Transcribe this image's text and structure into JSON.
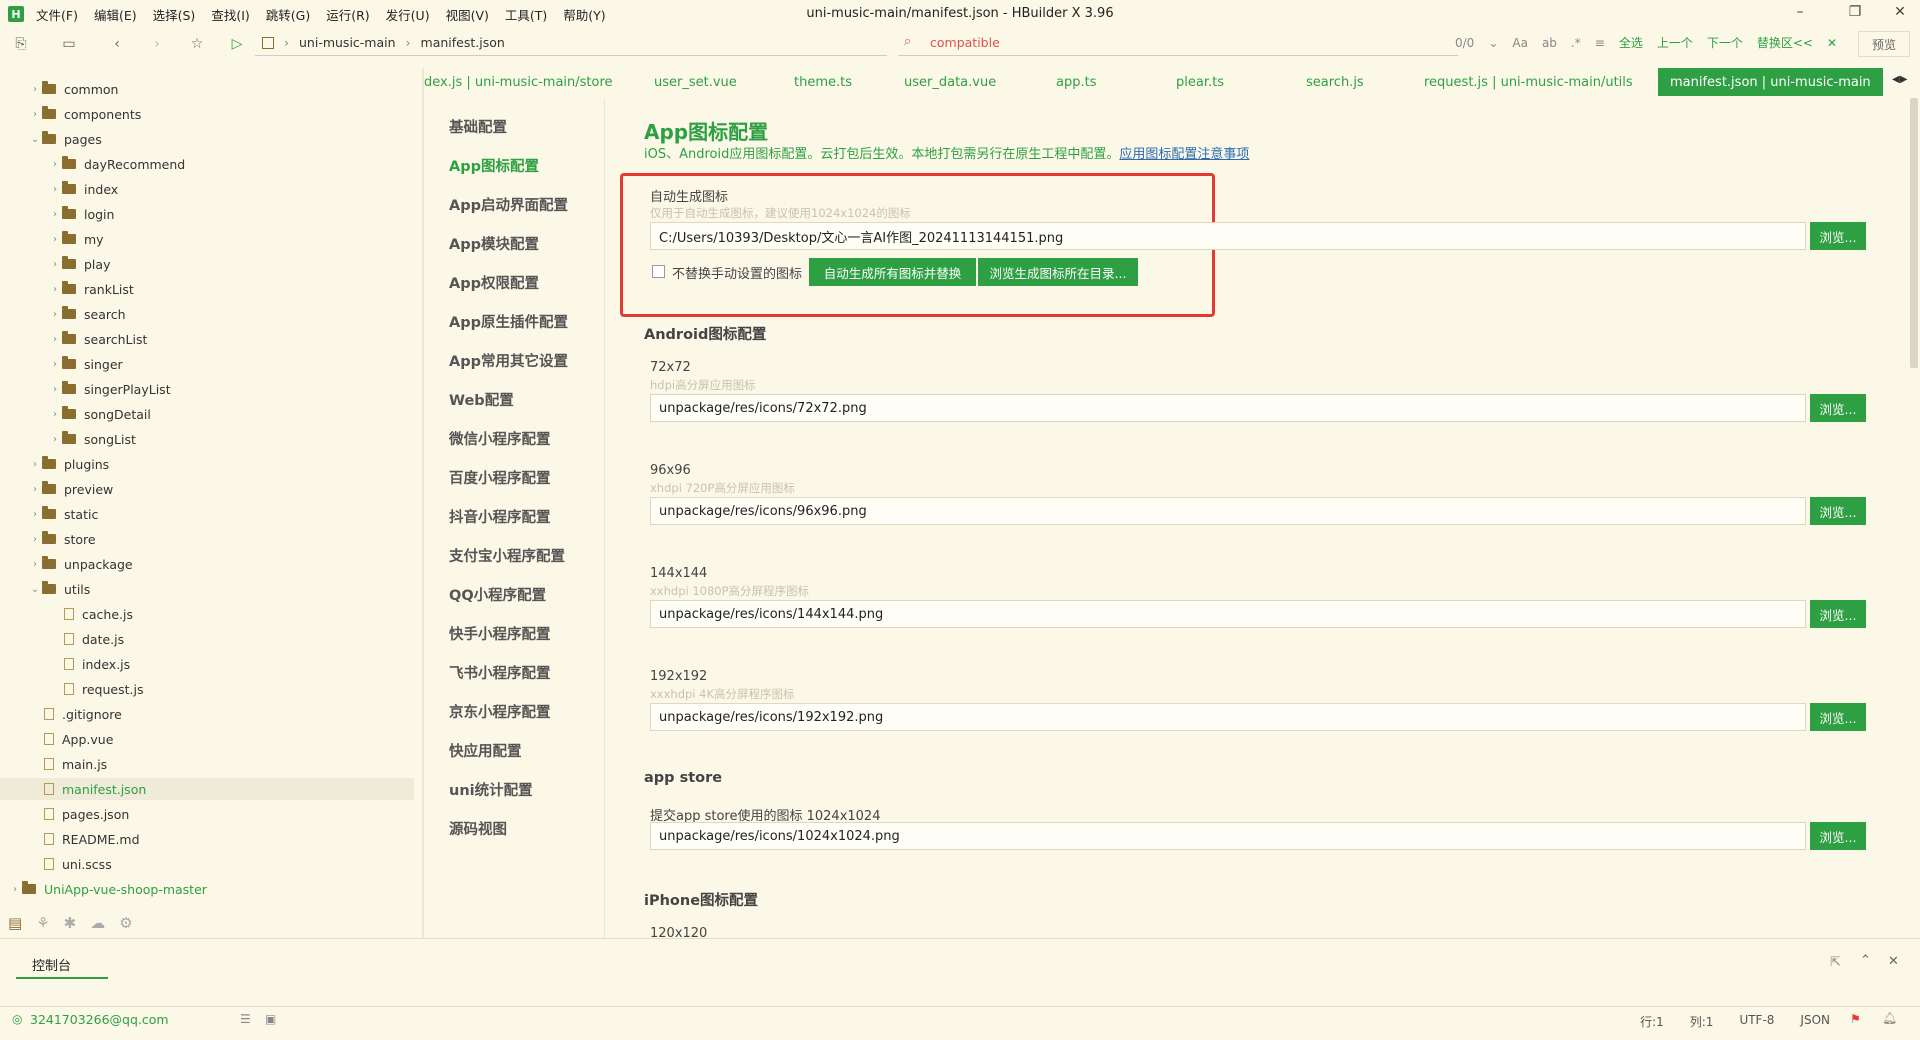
{
  "window": {
    "title": "uni-music-main/manifest.json - HBuilder X 3.96",
    "menu": [
      "文件(F)",
      "编辑(E)",
      "选择(S)",
      "查找(I)",
      "跳转(G)",
      "运行(R)",
      "发行(U)",
      "视图(V)",
      "工具(T)",
      "帮助(Y)"
    ]
  },
  "toolbar": {
    "breadcrumb": [
      "uni-music-main",
      "manifest.json"
    ],
    "search_value": "compatible",
    "match_count": "0/0",
    "find_select_all": "全选",
    "find_prev": "上一个",
    "find_next": "下一个",
    "find_replace": "替换区<<",
    "preview": "预览"
  },
  "tree": [
    {
      "label": "common",
      "type": "folder",
      "depth": 0,
      "expanded": false
    },
    {
      "label": "components",
      "type": "folder",
      "depth": 0,
      "expanded": false
    },
    {
      "label": "pages",
      "type": "folder",
      "depth": 0,
      "expanded": true
    },
    {
      "label": "dayRecommend",
      "type": "folder",
      "depth": 1,
      "expanded": false
    },
    {
      "label": "index",
      "type": "folder",
      "depth": 1,
      "expanded": false
    },
    {
      "label": "login",
      "type": "folder",
      "depth": 1,
      "expanded": false
    },
    {
      "label": "my",
      "type": "folder",
      "depth": 1,
      "expanded": false
    },
    {
      "label": "play",
      "type": "folder",
      "depth": 1,
      "expanded": false
    },
    {
      "label": "rankList",
      "type": "folder",
      "depth": 1,
      "expanded": false
    },
    {
      "label": "search",
      "type": "folder",
      "depth": 1,
      "expanded": false
    },
    {
      "label": "searchList",
      "type": "folder",
      "depth": 1,
      "expanded": false
    },
    {
      "label": "singer",
      "type": "folder",
      "depth": 1,
      "expanded": false
    },
    {
      "label": "singerPlayList",
      "type": "folder",
      "depth": 1,
      "expanded": false
    },
    {
      "label": "songDetail",
      "type": "folder",
      "depth": 1,
      "expanded": false
    },
    {
      "label": "songList",
      "type": "folder",
      "depth": 1,
      "expanded": false
    },
    {
      "label": "plugins",
      "type": "folder",
      "depth": 0,
      "expanded": false
    },
    {
      "label": "preview",
      "type": "folder",
      "depth": 0,
      "expanded": false
    },
    {
      "label": "static",
      "type": "folder",
      "depth": 0,
      "expanded": false
    },
    {
      "label": "store",
      "type": "folder",
      "depth": 0,
      "expanded": false
    },
    {
      "label": "unpackage",
      "type": "folder",
      "depth": 0,
      "expanded": false
    },
    {
      "label": "utils",
      "type": "folder",
      "depth": 0,
      "expanded": true
    },
    {
      "label": "cache.js",
      "type": "file",
      "depth": 1
    },
    {
      "label": "date.js",
      "type": "file",
      "depth": 1
    },
    {
      "label": "index.js",
      "type": "file",
      "depth": 1
    },
    {
      "label": "request.js",
      "type": "file",
      "depth": 1
    },
    {
      "label": ".gitignore",
      "type": "file",
      "depth": 0
    },
    {
      "label": "App.vue",
      "type": "file",
      "depth": 0
    },
    {
      "label": "main.js",
      "type": "file",
      "depth": 0
    },
    {
      "label": "manifest.json",
      "type": "file",
      "depth": 0,
      "active": true
    },
    {
      "label": "pages.json",
      "type": "file",
      "depth": 0
    },
    {
      "label": "README.md",
      "type": "file",
      "depth": 0
    },
    {
      "label": "uni.scss",
      "type": "file",
      "depth": 0
    },
    {
      "label": "UniApp-vue-shoop-master",
      "type": "project",
      "depth": -1
    }
  ],
  "tabs": [
    {
      "label": "dex.js | uni-music-main/store",
      "active": false
    },
    {
      "label": "user_set.vue",
      "active": false
    },
    {
      "label": "theme.ts",
      "active": false
    },
    {
      "label": "user_data.vue",
      "active": false
    },
    {
      "label": "app.ts",
      "active": false
    },
    {
      "label": "plear.ts",
      "active": false
    },
    {
      "label": "search.js",
      "active": false
    },
    {
      "label": "request.js | uni-music-main/utils",
      "active": false
    },
    {
      "label": "manifest.json | uni-music-main",
      "active": true
    }
  ],
  "settings_nav": [
    "基础配置",
    "App图标配置",
    "App启动界面配置",
    "App模块配置",
    "App权限配置",
    "App原生插件配置",
    "App常用其它设置",
    "Web配置",
    "微信小程序配置",
    "百度小程序配置",
    "抖音小程序配置",
    "支付宝小程序配置",
    "QQ小程序配置",
    "快手小程序配置",
    "飞书小程序配置",
    "京东小程序配置",
    "快应用配置",
    "uni统计配置",
    "源码视图"
  ],
  "settings_nav_active": 1,
  "main": {
    "title": "App图标配置",
    "desc": "iOS、Android应用图标配置。云打包后生效。本地打包需另行在原生工程中配置。",
    "desc_link": "应用图标配置注意事项",
    "auto": {
      "label": "自动生成图标",
      "hint": "仅用于自动生成图标，建议使用1024x1024的图标",
      "value": "C:/Users/10393/Desktop/文心一言AI作图_20241113144151.png",
      "checkbox_label": "不替换手动设置的图标",
      "btn_generate": "自动生成所有图标并替换",
      "btn_browse_dir": "浏览生成图标所在目录..."
    },
    "browse": "浏览...",
    "android_title": "Android图标配置",
    "android": [
      {
        "size": "72x72",
        "hint": "hdpi高分屏应用图标",
        "value": "unpackage/res/icons/72x72.png"
      },
      {
        "size": "96x96",
        "hint": "xhdpi 720P高分屏应用图标",
        "value": "unpackage/res/icons/96x96.png"
      },
      {
        "size": "144x144",
        "hint": "xxhdpi 1080P高分屏程序图标",
        "value": "unpackage/res/icons/144x144.png"
      },
      {
        "size": "192x192",
        "hint": "xxxhdpi 4K高分屏程序图标",
        "value": "unpackage/res/icons/192x192.png"
      }
    ],
    "appstore_title": "app store",
    "appstore_label": "提交app store使用的图标 1024x1024",
    "appstore_value": "unpackage/res/icons/1024x1024.png",
    "iphone_title": "iPhone图标配置",
    "iphone_first_size": "120x120"
  },
  "console": {
    "tab": "控制台"
  },
  "status": {
    "account": "3241703266@qq.com",
    "line": "行:1",
    "col": "列:1",
    "encoding": "UTF-8",
    "lang": "JSON"
  },
  "colors": {
    "accent": "#2ea043",
    "highlight_box": "#e53935",
    "background": "#fbf8e8"
  }
}
